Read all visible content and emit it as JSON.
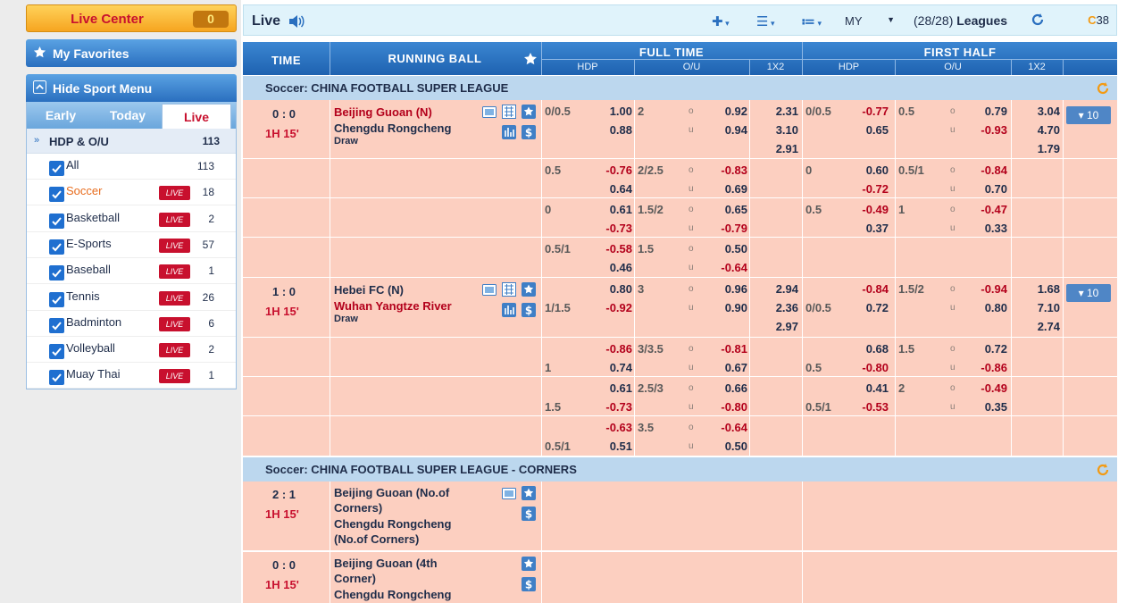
{
  "sidebar": {
    "live_center": {
      "label": "Live Center",
      "count": "0"
    },
    "favorites": "My Favorites",
    "hide_menu": "Hide Sport Menu",
    "tabs": [
      {
        "label": "Early"
      },
      {
        "label": "Today"
      },
      {
        "label": "Live"
      }
    ],
    "hdp": {
      "label": "HDP & O/U",
      "count": "113"
    },
    "sports": [
      {
        "name": "All",
        "live": "",
        "count": "113"
      },
      {
        "name": "Soccer",
        "live": "LIVE",
        "count": "18"
      },
      {
        "name": "Basketball",
        "live": "LIVE",
        "count": "2"
      },
      {
        "name": "E-Sports",
        "live": "LIVE",
        "count": "57"
      },
      {
        "name": "Baseball",
        "live": "LIVE",
        "count": "1"
      },
      {
        "name": "Tennis",
        "live": "LIVE",
        "count": "26"
      },
      {
        "name": "Badminton",
        "live": "LIVE",
        "count": "6"
      },
      {
        "name": "Volleyball",
        "live": "LIVE",
        "count": "2"
      },
      {
        "name": "Muay Thai",
        "live": "LIVE",
        "count": "1"
      }
    ]
  },
  "topbar": {
    "title": "Live",
    "odds_type": "MY",
    "leagues_count": "(28/28)",
    "leagues_label": "Leagues",
    "timer": "38"
  },
  "header": {
    "time": "TIME",
    "running_ball": "RUNNING BALL",
    "full_time": "FULL TIME",
    "first_half": "FIRST HALF",
    "hdp": "HDP",
    "ou": "O/U",
    "x12": "1X2"
  },
  "sections": [
    {
      "title": "Soccer: CHINA FOOTBALL SUPER LEAGUE"
    },
    {
      "title": "Soccer: CHINA FOOTBALL SUPER LEAGUE - CORNERS"
    }
  ],
  "labels": {
    "o": "o",
    "u": "u",
    "more": "▾ 10"
  },
  "matches": [
    {
      "score": "0 : 0",
      "period": "1H 15'",
      "home": "Beijing Guoan (N)",
      "away": "Chengdu Rongcheng",
      "draw": "Draw",
      "rows": [
        {
          "ft_hdp_line": "0/0.5",
          "ft_hdp1": "1.00",
          "ft_hdp2": "0.88",
          "ft_ou_line": "2",
          "ft_o": "0.92",
          "ft_u": "0.94",
          "ft_1": "2.31",
          "ft_x": "3.10",
          "ft_2": "2.91",
          "fh_hdp_line": "0/0.5",
          "fh_hdp1": "-0.77",
          "fh_hdp2": "0.65",
          "fh_ou_line": "0.5",
          "fh_o": "0.79",
          "fh_u": "-0.93",
          "fh_1": "3.04",
          "fh_x": "4.70",
          "fh_2": "1.79"
        },
        {
          "ft_hdp_line": "0.5",
          "ft_hdp1": "-0.76",
          "ft_hdp2": "0.64",
          "ft_ou_line": "2/2.5",
          "ft_o": "-0.83",
          "ft_u": "0.69",
          "fh_hdp_line": "0",
          "fh_hdp1": "0.60",
          "fh_hdp2": "-0.72",
          "fh_ou_line": "0.5/1",
          "fh_o": "-0.84",
          "fh_u": "0.70"
        },
        {
          "ft_hdp_line": "0",
          "ft_hdp1": "0.61",
          "ft_hdp2": "-0.73",
          "ft_ou_line": "1.5/2",
          "ft_o": "0.65",
          "ft_u": "-0.79",
          "fh_hdp_line": "0.5",
          "fh_hdp1": "-0.49",
          "fh_hdp2": "0.37",
          "fh_ou_line": "1",
          "fh_o": "-0.47",
          "fh_u": "0.33"
        },
        {
          "ft_hdp_line": "0.5/1",
          "ft_hdp1": "-0.58",
          "ft_hdp2": "0.46",
          "ft_ou_line": "1.5",
          "ft_o": "0.50",
          "ft_u": "-0.64"
        }
      ]
    },
    {
      "score": "1 : 0",
      "period": "1H 15'",
      "home": "Hebei FC (N)",
      "away": "Wuhan Yangtze River",
      "draw": "Draw",
      "rows": [
        {
          "ft_hdp_line": "1/1.5",
          "ft_hdp1": "0.80",
          "ft_hdp2": "-0.92",
          "ft_ou_line": "3",
          "ft_o": "0.96",
          "ft_u": "0.90",
          "ft_1": "2.94",
          "ft_x": "2.36",
          "ft_2": "2.97",
          "fh_hdp_line": "0/0.5",
          "fh_hdp1": "-0.84",
          "fh_hdp2": "0.72",
          "fh_ou_line": "1.5/2",
          "fh_o": "-0.94",
          "fh_u": "0.80",
          "fh_1": "1.68",
          "fh_x": "7.10",
          "fh_2": "2.74"
        },
        {
          "ft_hdp_line": "1",
          "ft_hdp1": "-0.86",
          "ft_hdp2": "0.74",
          "ft_ou_line": "3/3.5",
          "ft_o": "-0.81",
          "ft_u": "0.67",
          "fh_hdp_line": "0.5",
          "fh_hdp1": "0.68",
          "fh_hdp2": "-0.80",
          "fh_ou_line": "1.5",
          "fh_o": "0.72",
          "fh_u": "-0.86"
        },
        {
          "ft_hdp_line": "1.5",
          "ft_hdp1": "0.61",
          "ft_hdp2": "-0.73",
          "ft_ou_line": "2.5/3",
          "ft_o": "0.66",
          "ft_u": "-0.80",
          "fh_hdp_line": "0.5/1",
          "fh_hdp1": "0.41",
          "fh_hdp2": "-0.53",
          "fh_ou_line": "2",
          "fh_o": "-0.49",
          "fh_u": "0.35"
        },
        {
          "ft_hdp_line": "0.5/1",
          "ft_hdp1": "-0.63",
          "ft_hdp2": "0.51",
          "ft_ou_line": "3.5",
          "ft_o": "-0.64",
          "ft_u": "0.50"
        }
      ]
    }
  ],
  "corners": [
    {
      "score": "2 : 1",
      "period": "1H 15'",
      "home": "Beijing Guoan (No.of",
      "home2": "Corners)",
      "away": "Chengdu Rongcheng",
      "away2": "(No.of Corners)"
    },
    {
      "score": "0 : 0",
      "period": "1H 15'",
      "home": "Beijing Guoan (4th",
      "home2": "Corner)",
      "away": "Chengdu Rongcheng",
      "away2": ""
    }
  ],
  "colors": {
    "accent": "#2a6fbf",
    "live_badge": "#c8102e",
    "row_bg": "#fccfc0",
    "negative": "#b3001b"
  }
}
